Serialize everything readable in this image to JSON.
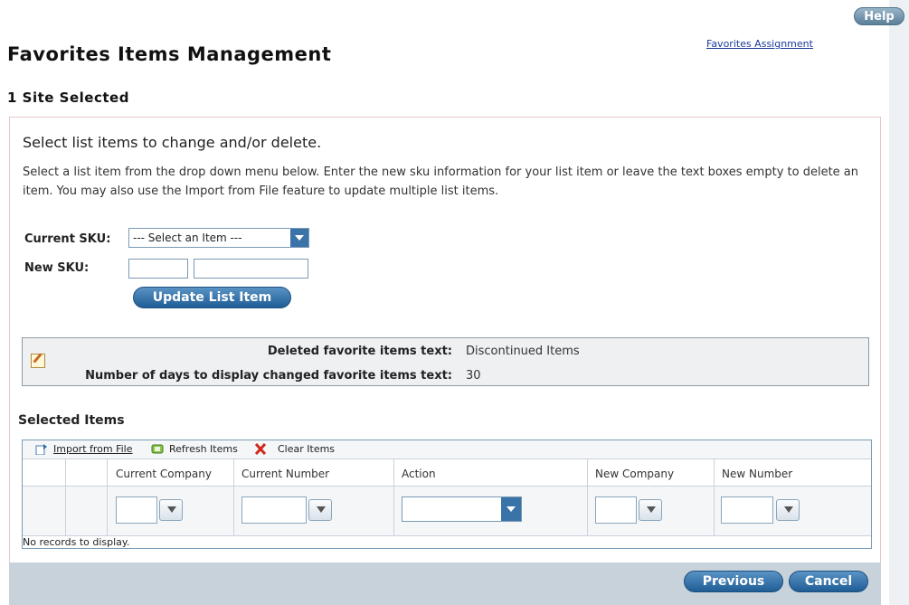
{
  "help": "Help",
  "favorites_assignment": "Favorites Assignment",
  "page_title": "Favorites Items Management",
  "site_selected": "1 Site Selected",
  "section_title": "Select list items to change and/or delete.",
  "description": "Select a list item from the drop down menu below. Enter the new sku information for your list item or leave the text boxes empty to delete an item. You may also use the Import from File feature to update multiple list items.",
  "form": {
    "current_sku_label": "Current SKU:",
    "current_sku_value": "--- Select an Item ---",
    "new_sku_label": "New SKU:",
    "update_button": "Update List Item"
  },
  "info": {
    "deleted_label": "Deleted favorite items text:",
    "deleted_value": "Discontinued Items",
    "days_label": "Number of days to display changed favorite items text:",
    "days_value": "30"
  },
  "selected_items": {
    "title": "Selected Items",
    "toolbar": {
      "import": "Import from File",
      "refresh": "Refresh Items",
      "clear": "Clear Items"
    },
    "columns": [
      "Current Company",
      "Current Number",
      "Action",
      "New Company",
      "New Number"
    ],
    "empty": "No records to display."
  },
  "footer": {
    "previous": "Previous",
    "cancel": "Cancel"
  },
  "colors": {
    "accent": "#2a6aa3",
    "footer_bg": "#c7d2db",
    "link": "#1a3a9a"
  }
}
